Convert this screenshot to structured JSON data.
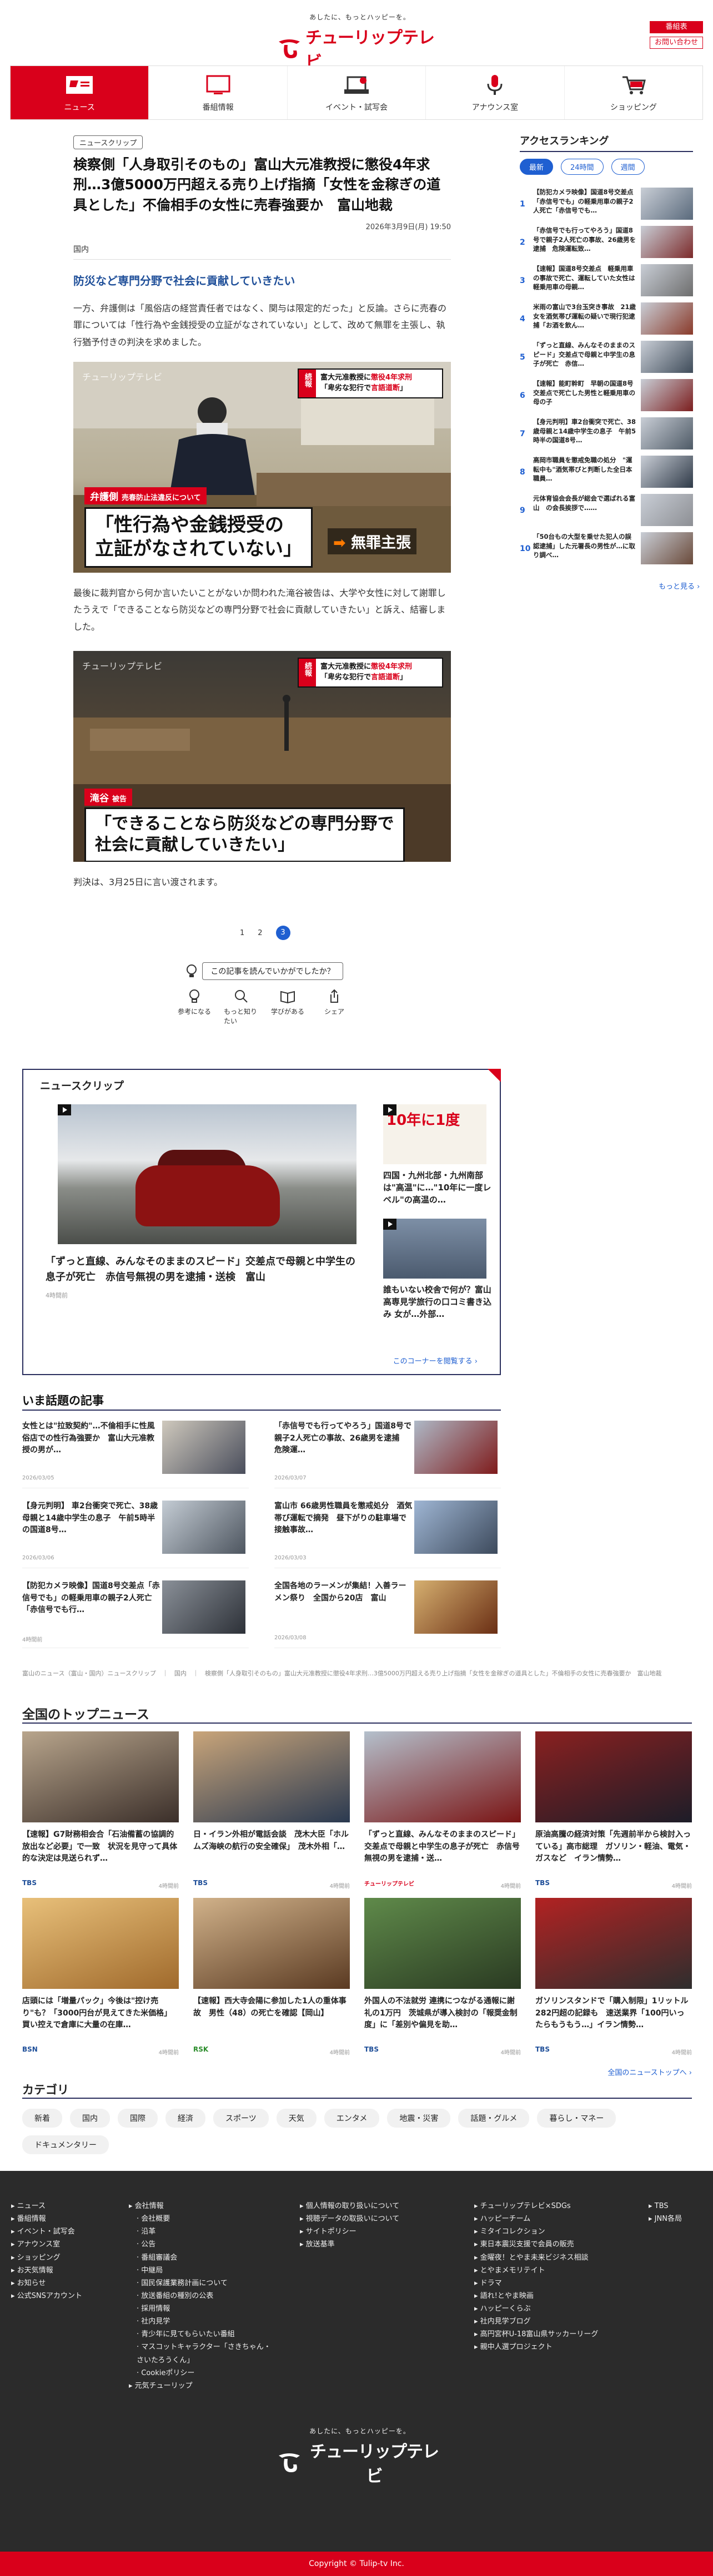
{
  "header": {
    "logo_tagline": "あしたに、もっとハッピーを。",
    "logo_text": "チューリップテレビ",
    "btn_member": "番組表",
    "btn_contact": "お問い合わせ"
  },
  "nav": [
    {
      "label": "ニュース",
      "icon": "news-icon",
      "active": true
    },
    {
      "label": "番組情報",
      "icon": "tv-program-icon",
      "active": false
    },
    {
      "label": "イベント・試写会",
      "icon": "event-icon",
      "active": false
    },
    {
      "label": "アナウンス室",
      "icon": "microphone-icon",
      "active": false
    },
    {
      "label": "ショッピング",
      "icon": "cart-icon",
      "active": false
    }
  ],
  "article": {
    "chip": "ニュースクリップ",
    "headline": "検察側「人身取引そのもの」富山大元准教授に懲役4年求刑…3億5000万円超える売り上げ指摘「女性を金稼ぎの道具とした」不倫相手の女性に売春強要か　富山地裁",
    "date": "2026年3月9日(月) 19:50",
    "category": "国内",
    "lead": "防災など専門分野で社会に貢献していきたい",
    "p1": "一方、弁護側は「風俗店の経営責任者ではなく、関与は限定的だった」と反論。さらに売春の罪については「性行為や金銭授受の立証がなされていない」として、改めて無罪を主張し、執行猶予付きの判決を求めました。",
    "p2": "最後に裁判官から何か言いたいことがないか問われた滝谷被告は、大学や女性に対して謝罪したうえで「できることなら防災などの専門分野で社会に貢献していきたい」と訴え、結審しました。",
    "p3": "判決は、3月25日に言い渡されます。",
    "img1": {
      "watermark": "チューリップテレビ",
      "badge_tag": "続報",
      "badge_line1a": "富大元准教授に",
      "badge_line1b": "懲役4年求刑",
      "badge_line2a": "「卑劣な犯行で",
      "badge_line2b": "言語道断",
      "badge_line2c": "」",
      "name_label": "弁護側",
      "name_sub": "売春防止法違反について",
      "caption": "「性行為や金銭授受の\n立証がなされていない」",
      "extra_pre": "➡",
      "extra": "無罪主張"
    },
    "img2": {
      "watermark": "チューリップテレビ",
      "badge_tag": "続報",
      "badge_line1a": "富大元准教授に",
      "badge_line1b": "懲役4年求刑",
      "badge_line2a": "「卑劣な犯行で",
      "badge_line2b": "言語道断",
      "badge_line2c": "」",
      "name_label": "滝谷",
      "name_sub": "被告",
      "caption": "「できることなら防災などの専門分野で\n社会に貢献していきたい」"
    }
  },
  "pager": {
    "p1": "1",
    "p2": "2",
    "p3": "3"
  },
  "feedback": {
    "question": "この記事を読んでいかがでしたか？",
    "items": [
      "参考になる",
      "もっと知りたい",
      "学びがある",
      "シェア"
    ]
  },
  "clip": {
    "title": "ニュースクリップ",
    "main_caption": "「ずっと直線、みんなそのままのスピード」交差点で母親と中学生の息子が死亡　赤信号無視の男を逮捕・送検　富山",
    "main_src": "4時間前",
    "side1_img_text": "10年に1度",
    "side1": "四国・九州北部・九州南部は\"高温\"に…\"10年に一度レベル\"の高温の…",
    "side2": "誰もいない校舎で何が？富山高専見学旅行の口コミ書き込み 女が…外部…",
    "more": "このコーナーを閲覧する ›"
  },
  "hot": {
    "title": "いま話題の記事",
    "items": [
      {
        "text": "女性とは\"拉致契約\"…不倫相手に性風俗店での性行為強要か　富山大元准教授の男が…",
        "date": "2026/03/05"
      },
      {
        "text": "「赤信号でも行ってやろう」国道8号で親子2人死亡の事故、26歳男を逮捕　危険運…",
        "date": "2026/03/07"
      },
      {
        "text": "【身元判明】 車2台衝突で死亡、38歳母親と14歳中学生の息子　午前5時半の国道8号…",
        "date": "2026/03/06"
      },
      {
        "text": "富山市 66歳男性職員を懲戒処分　酒気帯び運転で摘発　昼下がりの駐車場で接触事故…",
        "date": "2026/03/03"
      },
      {
        "text": "【防犯カメラ映像】国道8号交差点「赤信号でも」の軽乗用車の親子2人死亡「赤信号でも行…",
        "date": "4時間前"
      },
      {
        "text": "全国各地のラーメンが集結！入善ラーメン祭り　全国から20店　富山",
        "date": "2026/03/08"
      }
    ]
  },
  "breadcrumb": "富山のニュース（富山・国内）ニュースクリップ　｜　国内　｜　検察側「人身取引そのもの」富山大元准教授に懲役4年求刑…3億5000万円超える売り上げ指摘「女性を金稼ぎの道具とした」不倫相手の女性に売春強要か　富山地裁",
  "top": {
    "title": "全国のトップニュース",
    "items": [
      {
        "text": "【速報】G7財務相会合「石油備蓄の協調的放出など必要」で一致　状況を見守って具体的な決定は見送られず…",
        "src": "TBS",
        "time": "4時間前"
      },
      {
        "text": "日・イラン外相が電話会談　茂木大臣「ホルムズ海峡の航行の安全確保」　茂木外相「…",
        "src": "TBS",
        "time": "4時間前"
      },
      {
        "text": "「ずっと直線、みんなそのままのスピード」交差点で母親と中学生の息子が死亡　赤信号無視の男を逮捕・送…",
        "src": "チューリップテレビ",
        "time": "4時間前"
      },
      {
        "text": "原油高騰の経済対策「先週前半から検討入っている」高市総理　ガソリン・軽油、電気・ガスなど　イラン情勢…",
        "src": "TBS",
        "time": "4時間前"
      },
      {
        "text": "店頭には「増量パック」今後は\"控け売り\"も？「3000円台が見えてきた米価格」買い控えで倉庫に大量の在庫…",
        "src": "BSN",
        "time": "4時間前"
      },
      {
        "text": "【速報】西大寺会陽に参加した1人の重体事故　男性（48）の死亡を確認【岡山】",
        "src": "RSK",
        "time": "4時間前"
      },
      {
        "text": "外国人の不法就労 連携につながる通報に謝礼の1万円　茨城県が導入検討の「報奨金制度」に「差別や偏見を助…",
        "src": "TBS",
        "time": "4時間前"
      },
      {
        "text": "ガソリンスタンドで「購入制限」1リットル282円超の記録も　速送業界「100円いったらもうもう…」イラン情勢…",
        "src": "TBS",
        "time": "4時間前"
      }
    ],
    "more": "全国のニューストップへ ›"
  },
  "categories": {
    "title": "カテゴリ",
    "items": [
      "新着",
      "国内",
      "国際",
      "経済",
      "スポーツ",
      "天気",
      "エンタメ",
      "地震・災害",
      "話題・グルメ",
      "暮らし・マネー",
      "ドキュメンタリー"
    ]
  },
  "footer": {
    "col1": [
      "ニュース",
      "番組情報",
      "イベント・試写会",
      "アナウンス室",
      "ショッピング",
      "お天気情報",
      "お知らせ",
      "公式SNSアカウント"
    ],
    "col2": [
      "会社情報",
      "会社概要",
      "沿革",
      "公告",
      "番組審議会",
      "中継局",
      "国民保護業務計画について",
      "放送番組の種別の公表",
      "採用情報",
      "社内見学",
      "青少年に見てもらいたい番組",
      "マスコットキャラクター「さきちゃん・さいたろうくん」",
      "Cookieポリシー"
    ],
    "col2_extra": "元気チューリップ",
    "col3": [
      "個人情報の取り扱いについて",
      "視聴データの取扱いについて",
      "サイトポリシー",
      "放送基準"
    ],
    "col4": [
      "チューリップテレビ×SDGs",
      "ハッピーチーム",
      "ミタイコレクション",
      "東日本震災支援で会員の販売",
      "金曜夜！とやま未来ビジネス相談",
      "とやまメモリテイト",
      "ドラマ",
      "語れ!とやま映画",
      "ハッピーくらぶ",
      "社内見学ブログ",
      "高円宮杯U-18富山県サッカーリーグ",
      "親中人選プロジェクト"
    ],
    "col5": [
      "TBS",
      "JNN各局"
    ],
    "copyright": "Copyright © Tulip-tv Inc."
  },
  "sidebar": {
    "title": "アクセスランキング",
    "tabs": [
      "最新",
      "24時間",
      "週間"
    ],
    "ranks": [
      {
        "n": "1",
        "text": "【防犯カメラ映像】国道8号交差点「赤信号でも」の軽乗用車の親子2人死亡「赤信号でも…"
      },
      {
        "n": "2",
        "text": "「赤信号でも行ってやろう」国道8号で親子2人死亡の事故、26歳男を逮捕　危険運転致…"
      },
      {
        "n": "3",
        "text": "【速報】国道8号交差点　軽乗用車の事故で死亡、運転していた女性は軽乗用車の母親…"
      },
      {
        "n": "4",
        "text": "米雨の富山で3台玉突き事故　21歳女を酒気帯び運転の疑いで現行犯逮捕「お酒を飲ん…"
      },
      {
        "n": "5",
        "text": "「ずっと直線、みんなそのままのスピード」交差点で母親と中学生の息子が死亡　赤信…"
      },
      {
        "n": "6",
        "text": "【速報】能町幹町　早朝の国道8号　交差点で死亡した男性と軽乗用車の母の子"
      },
      {
        "n": "7",
        "text": "【身元判明】車2台衝突で死亡、38歳母親と14歳中学生の息子　午前5時半の国道8号…"
      },
      {
        "n": "8",
        "text": "高岡市職員を懲戒免職の処分　\"運転中も\"酒気帯びと判断した全日本職員…"
      },
      {
        "n": "9",
        "text": "元体育協会会長が総会で選ばれる富山　の会長挨拶で……"
      },
      {
        "n": "10",
        "text": "「50台もの大型を乗せた犯人の誤認逮捕」した元署長の男性が…に取り調べ…"
      }
    ],
    "more": "もっと見る ›"
  }
}
